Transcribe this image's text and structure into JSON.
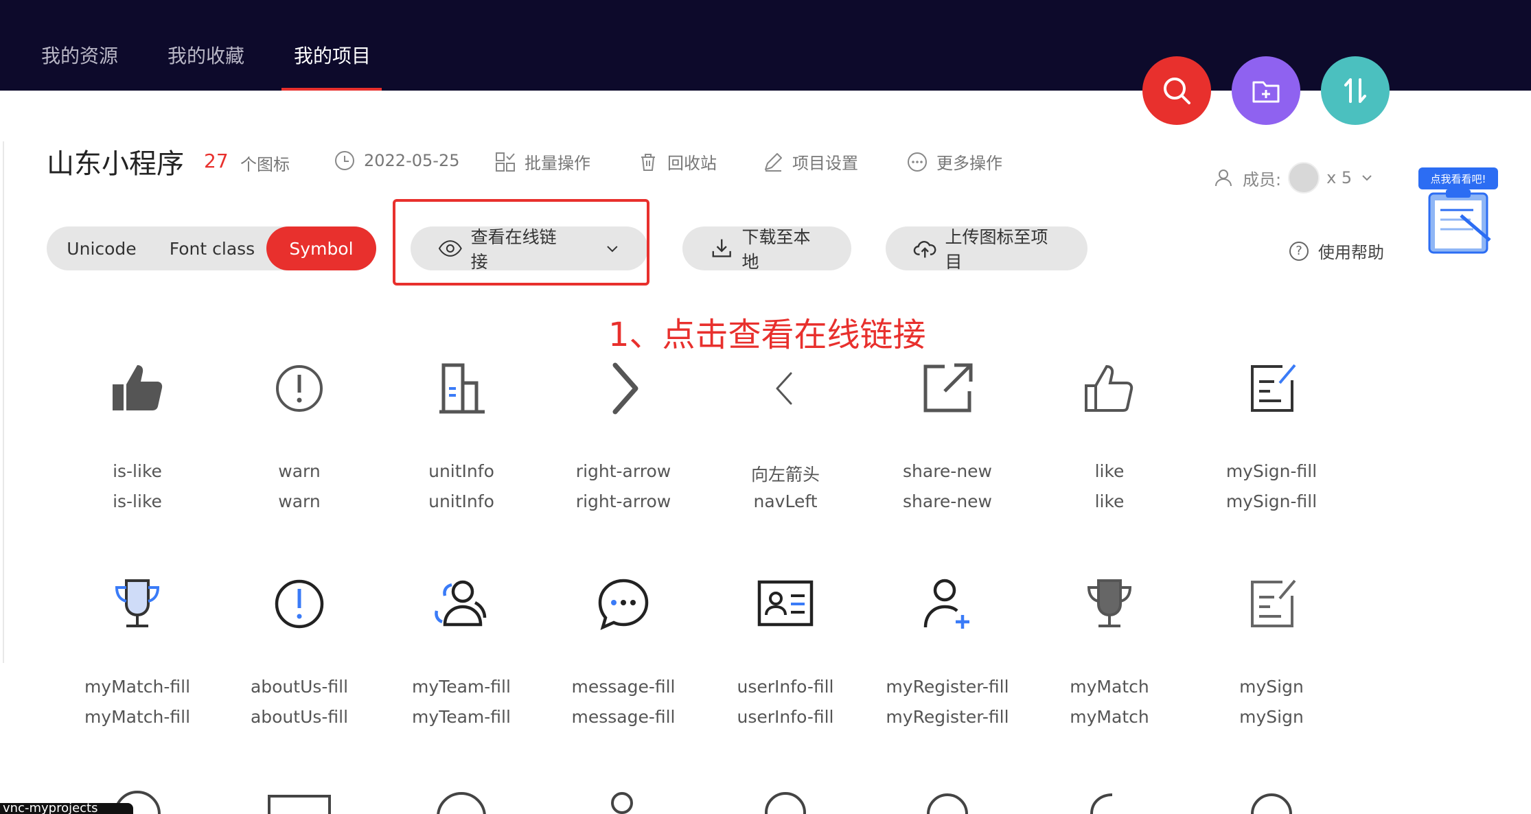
{
  "nav": {
    "tabs": [
      "我的资源",
      "我的收藏",
      "我的项目"
    ],
    "active_index": 2
  },
  "fabs": [
    {
      "icon": "search-icon",
      "color": "#e8302d"
    },
    {
      "icon": "folder-add-icon",
      "color": "#8f62f0"
    },
    {
      "icon": "sort-icon",
      "color": "#4bc0bf"
    }
  ],
  "project": {
    "title": "山东小程序",
    "icon_count": "27",
    "icon_count_label": "个图标",
    "date": "2022-05-25",
    "batch_label": "批量操作",
    "recycle_label": "回收站",
    "settings_label": "项目设置",
    "more_label": "更多操作",
    "members_label": "成员:",
    "members_count": "x 5"
  },
  "hint": {
    "badge": "点我看看吧!"
  },
  "toolbar": {
    "seg": [
      "Unicode",
      "Font class",
      "Symbol"
    ],
    "seg_active": 2,
    "view_link_label": "查看在线链接",
    "download_label": "下载至本地",
    "upload_label": "上传图标至项目",
    "help_label": "使用帮助"
  },
  "annotation": "1、点击查看在线链接",
  "icons": [
    {
      "name": "is-like",
      "code": "is-like",
      "icon": "thumb-up-fill-icon"
    },
    {
      "name": "warn",
      "code": "warn",
      "icon": "warning-circle-icon"
    },
    {
      "name": "unitInfo",
      "code": "unitInfo",
      "icon": "building-icon"
    },
    {
      "name": "right-arrow",
      "code": "right-arrow",
      "icon": "chevron-right-icon"
    },
    {
      "name": "向左箭头",
      "code": "navLeft",
      "icon": "chevron-left-icon"
    },
    {
      "name": "share-new",
      "code": "share-new",
      "icon": "share-icon"
    },
    {
      "name": "like",
      "code": "like",
      "icon": "thumb-up-icon"
    },
    {
      "name": "mySign-fill",
      "code": "mySign-fill",
      "icon": "sign-fill-icon"
    },
    {
      "name": "myMatch-fill",
      "code": "myMatch-fill",
      "icon": "trophy-fill-icon"
    },
    {
      "name": "aboutUs-fill",
      "code": "aboutUs-fill",
      "icon": "info-fill-icon"
    },
    {
      "name": "myTeam-fill",
      "code": "myTeam-fill",
      "icon": "team-fill-icon"
    },
    {
      "name": "message-fill",
      "code": "message-fill",
      "icon": "message-icon"
    },
    {
      "name": "userInfo-fill",
      "code": "userInfo-fill",
      "icon": "user-card-icon"
    },
    {
      "name": "myRegister-fill",
      "code": "myRegister-fill",
      "icon": "user-add-icon"
    },
    {
      "name": "myMatch",
      "code": "myMatch",
      "icon": "trophy-icon"
    },
    {
      "name": "mySign",
      "code": "mySign",
      "icon": "sign-icon"
    }
  ],
  "bottom_tag": "vnc-myprojects"
}
